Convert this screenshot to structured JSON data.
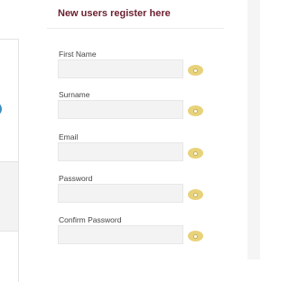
{
  "register": {
    "heading": "New users register here",
    "fields": [
      {
        "label": "First Name",
        "value": ""
      },
      {
        "label": "Surname",
        "value": ""
      },
      {
        "label": "Email",
        "value": ""
      },
      {
        "label": "Password",
        "value": ""
      },
      {
        "label": "Confirm Password",
        "value": ""
      }
    ]
  },
  "colors": {
    "heading": "#6b1f2f",
    "eye_button": "#e8d27a",
    "input_background": "#f3f3f3"
  },
  "icons": {
    "reveal": "eye-icon"
  }
}
